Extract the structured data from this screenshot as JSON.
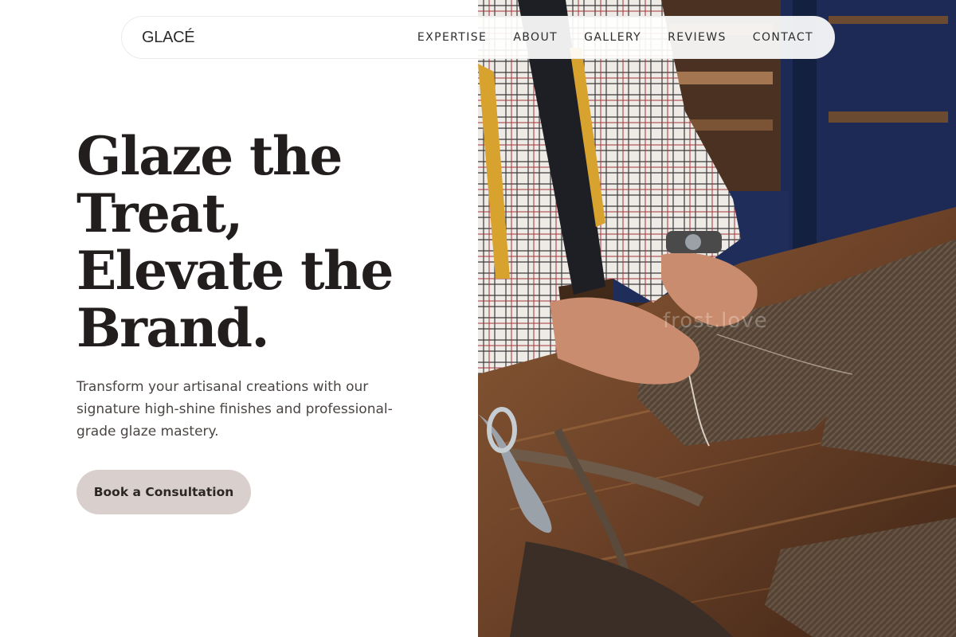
{
  "brand": {
    "logo": "GLACÉ"
  },
  "nav": {
    "items": [
      {
        "label": "EXPERTISE"
      },
      {
        "label": "ABOUT"
      },
      {
        "label": "GALLERY"
      },
      {
        "label": "REVIEWS"
      },
      {
        "label": "CONTACT"
      }
    ]
  },
  "hero": {
    "headline_lines": [
      "Glaze the",
      "Treat,",
      "Elevate the",
      "Brand."
    ],
    "subtitle": "Transform your artisanal creations with our signature high-shine finishes and professional-grade glaze mastery.",
    "cta_label": "Book a Consultation",
    "image_watermark": "frost.love"
  },
  "colors": {
    "accent_button": "#d9cfcd",
    "headline_text": "#221e1d",
    "body_text": "#4a4543"
  }
}
